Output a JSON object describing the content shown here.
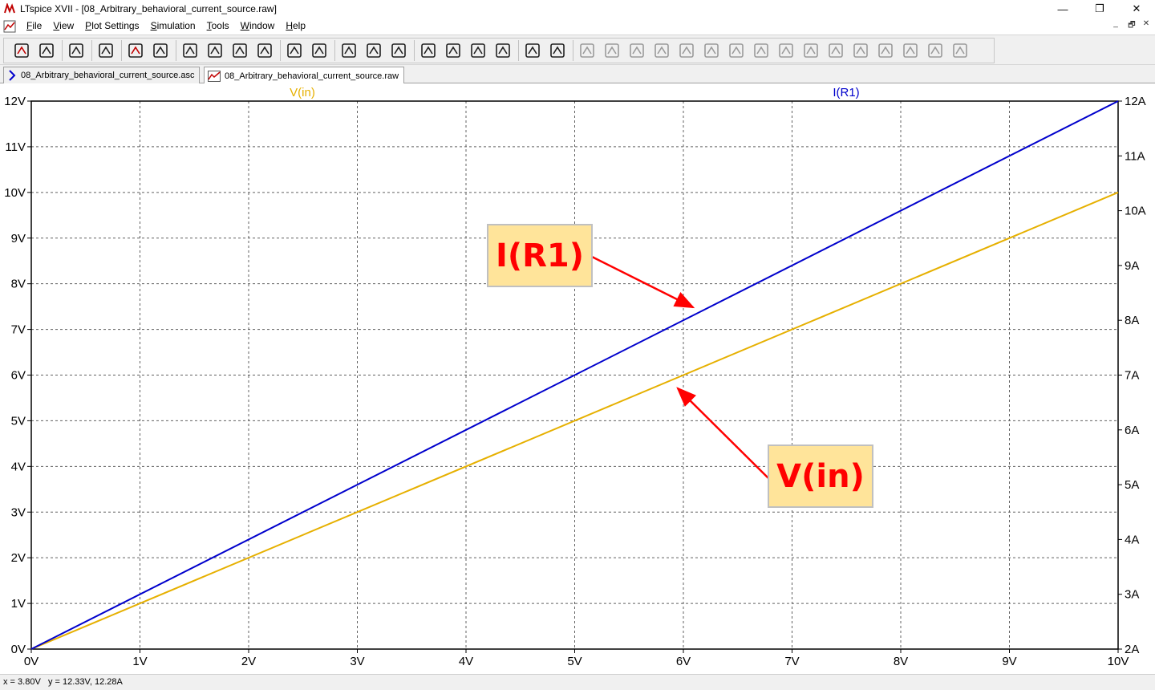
{
  "window": {
    "title": "LTspice XVII - [08_Arbitrary_behavioral_current_source.raw]",
    "minimize": "—",
    "restore": "❐",
    "close": "✕"
  },
  "menu": {
    "items": [
      "File",
      "View",
      "Plot Settings",
      "Simulation",
      "Tools",
      "Window",
      "Help"
    ]
  },
  "mdi_controls": {
    "minimize": "_",
    "restore": "🗗",
    "close": "✕"
  },
  "toolbar": {
    "buttons": [
      "new-schematic",
      "open",
      "save",
      "control-panel",
      "run",
      "halt",
      "zoom-area",
      "zoom-in",
      "zoom-out",
      "zoom-full",
      "autorange",
      "mark-data-points",
      "tile-horizontal",
      "tile-vertical",
      "cascade",
      "cut",
      "copy",
      "paste",
      "find",
      "print",
      "print-setup",
      "draw-wire",
      "ground",
      "label-net",
      "resistor",
      "capacitor",
      "inductor",
      "diode",
      "component",
      "move",
      "drag",
      "undo",
      "redo",
      "rotate",
      "mirror",
      "text",
      "spice-directive"
    ]
  },
  "tabs": [
    {
      "label": "08_Arbitrary_behavioral_current_source.asc",
      "active": false,
      "icon": "schematic-icon"
    },
    {
      "label": "08_Arbitrary_behavioral_current_source.raw",
      "active": true,
      "icon": "waveform-icon"
    }
  ],
  "status": {
    "text": "x = 3.80V   y = 12.33V, 12.28A"
  },
  "callouts": {
    "ir1": "I(R1)",
    "vin": "V(in)"
  },
  "colors": {
    "vin": "#e6b000",
    "ir1": "#0000cc",
    "callout_text": "#ff0000",
    "callout_bg": "#ffe49a"
  },
  "chart_data": {
    "type": "line",
    "title": "",
    "x": {
      "range": [
        0,
        10
      ],
      "ticks": [
        "0V",
        "1V",
        "2V",
        "3V",
        "4V",
        "5V",
        "6V",
        "7V",
        "8V",
        "9V",
        "10V"
      ]
    },
    "y_left": {
      "range": [
        0,
        12
      ],
      "ticks": [
        "0V",
        "1V",
        "2V",
        "3V",
        "4V",
        "5V",
        "6V",
        "7V",
        "8V",
        "9V",
        "10V",
        "11V",
        "12V"
      ]
    },
    "y_right": {
      "range": [
        2,
        12
      ],
      "ticks": [
        "2A",
        "3A",
        "4A",
        "5A",
        "6A",
        "7A",
        "8A",
        "9A",
        "10A",
        "11A",
        "12A"
      ]
    },
    "grid": true,
    "series": [
      {
        "name": "V(in)",
        "axis": "left",
        "x": [
          0,
          10
        ],
        "y": [
          0,
          10
        ]
      },
      {
        "name": "I(R1)",
        "axis": "left",
        "x": [
          0,
          10
        ],
        "y": [
          0,
          12
        ]
      }
    ]
  }
}
